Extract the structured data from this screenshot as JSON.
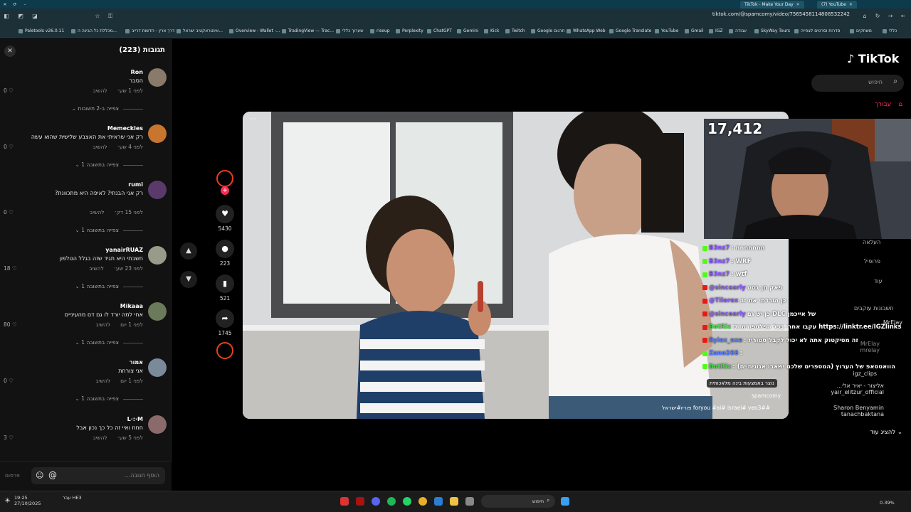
{
  "browser": {
    "tabs": [
      {
        "label": "TikTok - Make Your Day"
      },
      {
        "label": "(7) YouTube"
      }
    ],
    "address": "tiktok.com/@spamcomy/video/7565458114808532242",
    "bookmarks": [
      "Paletools v26.0.11",
      "מכללת כל הבינה ה...",
      "דרך ארץ - חדשות דרייב",
      "אינטראקטיב ישראל...",
      "Overview - Wallet -...",
      "TradingView — Trac...",
      "שערוך כללי",
      "riseup",
      "Perplexity",
      "ChatGPT",
      "Gemini",
      "Kick",
      "Twitch",
      "Google תרגום",
      "WhatsApp Web",
      "Google Translate",
      "YouTube",
      "Gmail",
      "IGZ",
      "עבודה",
      "SkyWay Tours",
      "סדרות וסרטים לצפייה",
      "משחקים",
      "כללי"
    ]
  },
  "comments_panel": {
    "title": "תגובות (223)",
    "comments": [
      {
        "name": "Ron",
        "text": "הסבר",
        "time": "לפני 1 שע׳",
        "reply": "להשיב",
        "likes": "0",
        "replies": "צפייה ב-2 תשובות"
      },
      {
        "name": "Memeckles",
        "text": "רק אני שראיתי את האצבע שלישית שהוא עשה",
        "time": "לפני 4 שע׳",
        "reply": "להשיב",
        "likes": "0",
        "replies": "צפייה בתשובה 1"
      },
      {
        "name": "rumi",
        "text": "רק אני הבנתי? לאיפה היא מתכוונת?",
        "time": "לפני 15 דק׳",
        "reply": "להשיב",
        "likes": "0",
        "replies": "צפייה בתשובה 1"
      },
      {
        "name": "yanairRUAZ",
        "text": "חשבתי היא תגיד שזה בגלל הטלפון",
        "time": "לפני 23 שע׳",
        "reply": "להשיב",
        "likes": "18",
        "replies": "צפייה בתשובה 1"
      },
      {
        "name": "Mikaaa",
        "text": "אחי למה יורד לו גם דם מהעיניים",
        "time": "לפני 1 יום",
        "reply": "להשיב",
        "likes": "80",
        "replies": "צפייה בתשובה 1"
      },
      {
        "name": "אמור",
        "text": "אני צורחת",
        "time": "לפני 1 יום",
        "reply": "להשיב",
        "likes": "0",
        "replies": "צפייה בתשובה 1"
      },
      {
        "name": "L·:·M",
        "text": "חחח ואיי זה כל כך נכון אבל",
        "time": "לפני 5 שע׳",
        "reply": "להשיב",
        "likes": "3",
        "replies": ""
      }
    ],
    "composer_placeholder": "הוסף תגובה...",
    "post_label": "פרסום"
  },
  "actions": {
    "likes": "5430",
    "comments": "223",
    "saves": "521",
    "shares": "1745"
  },
  "video": {
    "ai_label": "נוצר באמצעות בינה מלאכותית",
    "username": "spamcomy",
    "tags": "#foryou #ai# israel# veo3# פוריו#ישראל"
  },
  "header": {
    "logo": "TikTok",
    "search_placeholder": "חיפוש",
    "for_you": "עבורך"
  },
  "sidenav": [
    "העלאה",
    "פרופיל",
    "עוד",
    "חשבונות עוקבים"
  ],
  "overlay": {
    "counter": "17,412",
    "chat": [
      {
        "user": "B3nz7",
        "msg": ": חחחחחחח",
        "color": "#8a5cf5"
      },
      {
        "user": "B3nz7",
        "msg": ": WRF",
        "color": "#8a5cf5"
      },
      {
        "user": "B3nz7",
        "msg": ": wtf",
        "color": "#8a5cf5"
      },
      {
        "user": "@sincearly",
        "msg": " פאק חן בסט",
        "color": "#8a5cf5"
      },
      {
        "user": "@Tilorex",
        "msg": " כן הורדתי את זה",
        "color": "#8a5cf5"
      },
      {
        "user": "@sincearly",
        "msg": " כן יש גם DLC של אייכמן",
        "color": "#8a5cf5"
      },
      {
        "user": "BotRix",
        "msg": " :עקבו אחרי בכל הפלטפורמות https://linktr.ee/IGZlinks",
        "color": "#4ade4a"
      },
      {
        "user": "Ryiex_exe",
        "msg": " : זה מטיקטוק אתה לא יכול לקבל סטוריז",
        "color": "#5b7cf5"
      },
      {
        "user": "Zano266",
        "msg": " :",
        "color": "#5b7cf5"
      },
      {
        "user": "BotRix",
        "msg": " : הוואטסאפ של הערוץ (המספרים שלכם ישארו אנונימיים)",
        "color": "#4ade4a"
      }
    ],
    "suggestions": [
      {
        "name": "MrElay",
        "handle": "mrelay"
      },
      {
        "name": "igz_clips",
        "handle": ""
      },
      {
        "name": "אליצור - יאיר אלי...",
        "handle": "yair_elitzur_official"
      },
      {
        "name": "Sharon Benyamin",
        "handle": "tanachbaktana"
      }
    ],
    "show_more": "להציג עוד"
  },
  "taskbar": {
    "time": "19:25",
    "date": "27/10/2025",
    "lang": "עבר\nHE3",
    "search": "חיפוש",
    "weather": "0.39%"
  }
}
